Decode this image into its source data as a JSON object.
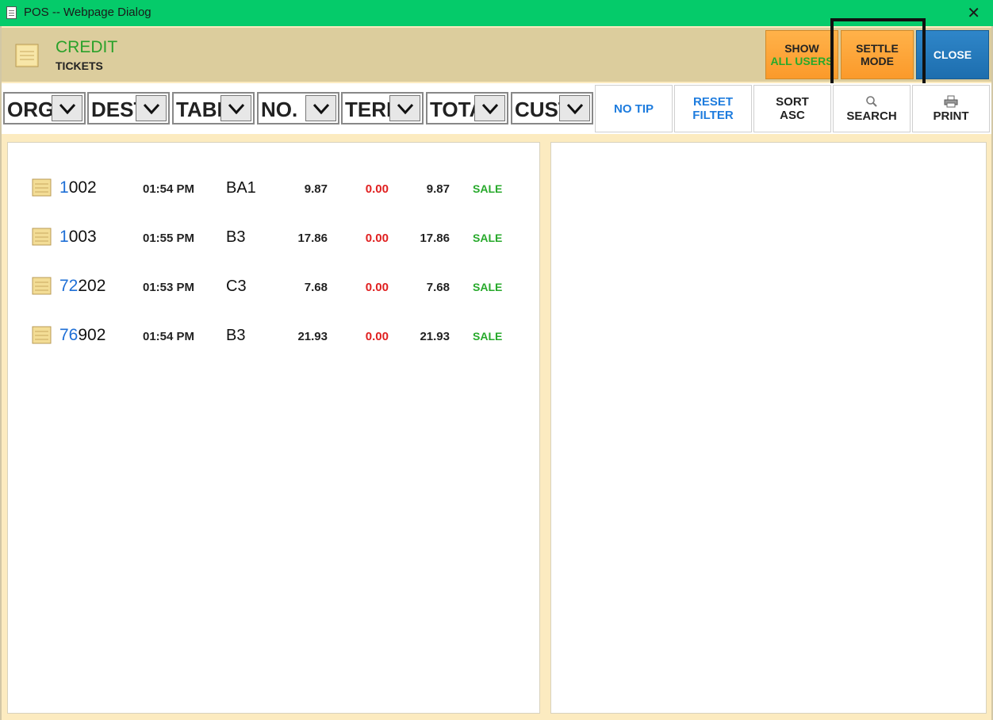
{
  "window": {
    "title": "POS -- Webpage Dialog",
    "close_glyph": "✕"
  },
  "header": {
    "title": "CREDIT",
    "subtitle": "TICKETS",
    "show_all_users": {
      "line1": "SHOW",
      "line2": "ALL USERS"
    },
    "settle_mode": {
      "line1": "SETTLE",
      "line2": "MODE"
    },
    "close_label": "CLOSE"
  },
  "filters": [
    {
      "label": "ORG"
    },
    {
      "label": "DEST"
    },
    {
      "label": "TABLE"
    },
    {
      "label": "NO."
    },
    {
      "label": "TERM"
    },
    {
      "label": "TOTAL"
    },
    {
      "label": "CUST"
    }
  ],
  "toolbar": {
    "no_tip": "NO TIP",
    "reset_filter": {
      "line1": "RESET",
      "line2": "FILTER"
    },
    "sort": {
      "line1": "SORT",
      "line2": "ASC"
    },
    "search": "SEARCH",
    "print": "PRINT"
  },
  "tickets": [
    {
      "num_hl": "1",
      "num_rest": "002",
      "time": "01:54 PM",
      "table": "BA1",
      "amount": "9.87",
      "tip": "0.00",
      "total": "9.87",
      "type": "SALE"
    },
    {
      "num_hl": "1",
      "num_rest": "003",
      "time": "01:55 PM",
      "table": "B3",
      "amount": "17.86",
      "tip": "0.00",
      "total": "17.86",
      "type": "SALE"
    },
    {
      "num_hl": "72",
      "num_rest": "202",
      "time": "01:53 PM",
      "table": "C3",
      "amount": "7.68",
      "tip": "0.00",
      "total": "7.68",
      "type": "SALE"
    },
    {
      "num_hl": "76",
      "num_rest": "902",
      "time": "01:54 PM",
      "table": "B3",
      "amount": "21.93",
      "tip": "0.00",
      "total": "21.93",
      "type": "SALE"
    }
  ],
  "colors": {
    "titlebar": "#05cb6a",
    "header": "#dccd9d",
    "accent_green": "#27a92b",
    "accent_blue": "#1e7cde",
    "tip_red": "#e02020",
    "orange_button": "#fb9a2a",
    "close_button": "#1d6eae"
  }
}
